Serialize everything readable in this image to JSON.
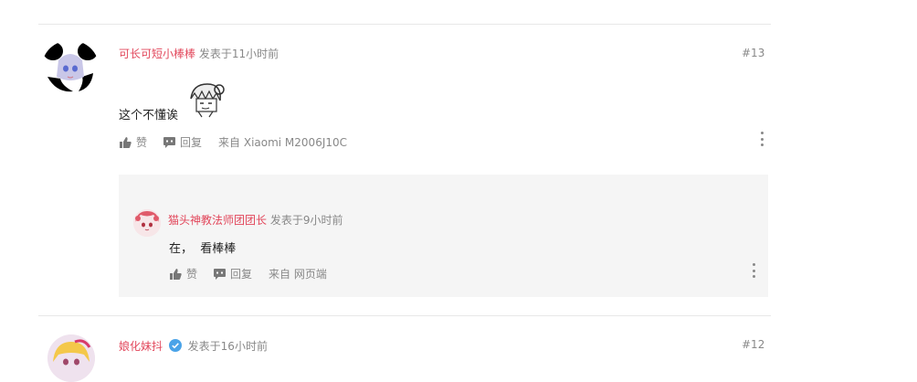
{
  "comments": [
    {
      "username": "可长可短小棒棒",
      "posted": "发表于11小时前",
      "floor": "#13",
      "text": "这个不懂诶",
      "like_label": "赞",
      "reply_label": "回复",
      "source": "来自 Xiaomi  M2006J10C",
      "replies": [
        {
          "username": "猫头神教法师团团长",
          "posted": "发表于9小时前",
          "text": "在，  看棒棒",
          "like_label": "赞",
          "reply_label": "回复",
          "source": "来自 网页端"
        }
      ]
    },
    {
      "username": "娘化妹抖",
      "verified": true,
      "posted": "发表于16小时前",
      "floor": "#12"
    }
  ],
  "colors": {
    "username": "#e2475b",
    "meta": "#888888",
    "reply_bg": "#f5f5f5",
    "verified": "#4aa3e8"
  }
}
